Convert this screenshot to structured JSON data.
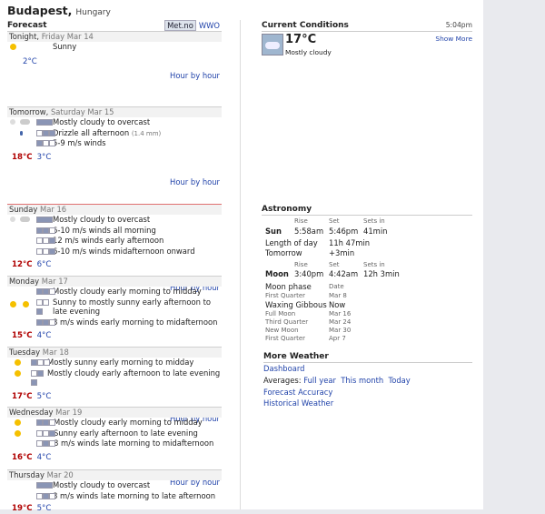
{
  "location": {
    "city": "Budapest",
    "country": "Hungary"
  },
  "forecast": {
    "header": "Forecast",
    "sources": [
      "Met.no",
      "WWO"
    ],
    "hour_by_hour": "Hour by hour",
    "days": [
      {
        "day": "Tonight,",
        "date": "Friday Mar 14",
        "lines": [
          "Sunny"
        ],
        "high": "",
        "low": "2°C"
      },
      {
        "day": "Tomorrow,",
        "date": "Saturday Mar 15",
        "lines": [
          "Mostly cloudy to overcast",
          "Drizzle all afternoon",
          "5-9 m/s winds"
        ],
        "extra": "(1.4 mm)",
        "high": "18°C",
        "low": "3°C"
      },
      {
        "day": "Sunday",
        "date": "Mar 16",
        "lines": [
          "Mostly cloudy to overcast",
          "6-10 m/s winds all morning",
          "12 m/s winds early afternoon",
          "6-10 m/s winds midafternoon onward"
        ],
        "high": "12°C",
        "low": "6°C"
      },
      {
        "day": "Monday",
        "date": "Mar 17",
        "lines": [
          "Mostly cloudy early morning to midday",
          "Sunny to mostly sunny early afternoon to late evening",
          "8 m/s winds early morning to midafternoon"
        ],
        "high": "15°C",
        "low": "4°C"
      },
      {
        "day": "Tuesday",
        "date": "Mar 18",
        "lines": [
          "Mostly sunny early morning to midday",
          "Mostly cloudy early afternoon to late evening"
        ],
        "high": "17°C",
        "low": "5°C"
      },
      {
        "day": "Wednesday",
        "date": "Mar 19",
        "lines": [
          "Mostly cloudy early morning to midday",
          "Sunny early afternoon to late evening",
          "8 m/s winds late morning to midafternoon"
        ],
        "high": "16°C",
        "low": "4°C"
      },
      {
        "day": "Thursday",
        "date": "Mar 20",
        "lines": [
          "Mostly cloudy to overcast",
          "8 m/s winds late morning to late afternoon"
        ],
        "high": "19°C",
        "low": "5°C"
      }
    ]
  },
  "current": {
    "header": "Current Conditions",
    "time": "5:04pm",
    "temp": "17°C",
    "desc": "Mostly cloudy",
    "show_more": "Show More"
  },
  "astronomy": {
    "header": "Astronomy",
    "rise": "Rise",
    "set": "Set",
    "sets_in": "Sets in",
    "sun": {
      "label": "Sun",
      "rise": "5:58am",
      "set": "5:46pm",
      "in": "41min"
    },
    "length_label": "Length of day",
    "length": "11h 47min",
    "tomorrow_label": "Tomorrow",
    "tomorrow": "+3min",
    "moon": {
      "label": "Moon",
      "rise": "3:40pm",
      "set": "4:42am",
      "in": "12h 3min"
    },
    "phase_label": "Moon phase",
    "date_label": "Date",
    "phases": [
      {
        "name": "First Quarter",
        "date": "Mar 8"
      },
      {
        "name": "Waxing Gibbous",
        "date": "Now"
      },
      {
        "name": "Full Moon",
        "date": "Mar 16"
      },
      {
        "name": "Third Quarter",
        "date": "Mar 24"
      },
      {
        "name": "New Moon",
        "date": "Mar 30"
      },
      {
        "name": "First Quarter",
        "date": "Apr 7"
      }
    ]
  },
  "more": {
    "header": "More Weather",
    "dashboard": "Dashboard",
    "averages_label": "Averages:",
    "averages": [
      "Full year",
      "This month",
      "Today"
    ],
    "accuracy": "Forecast Accuracy",
    "historical": "Historical Weather"
  }
}
